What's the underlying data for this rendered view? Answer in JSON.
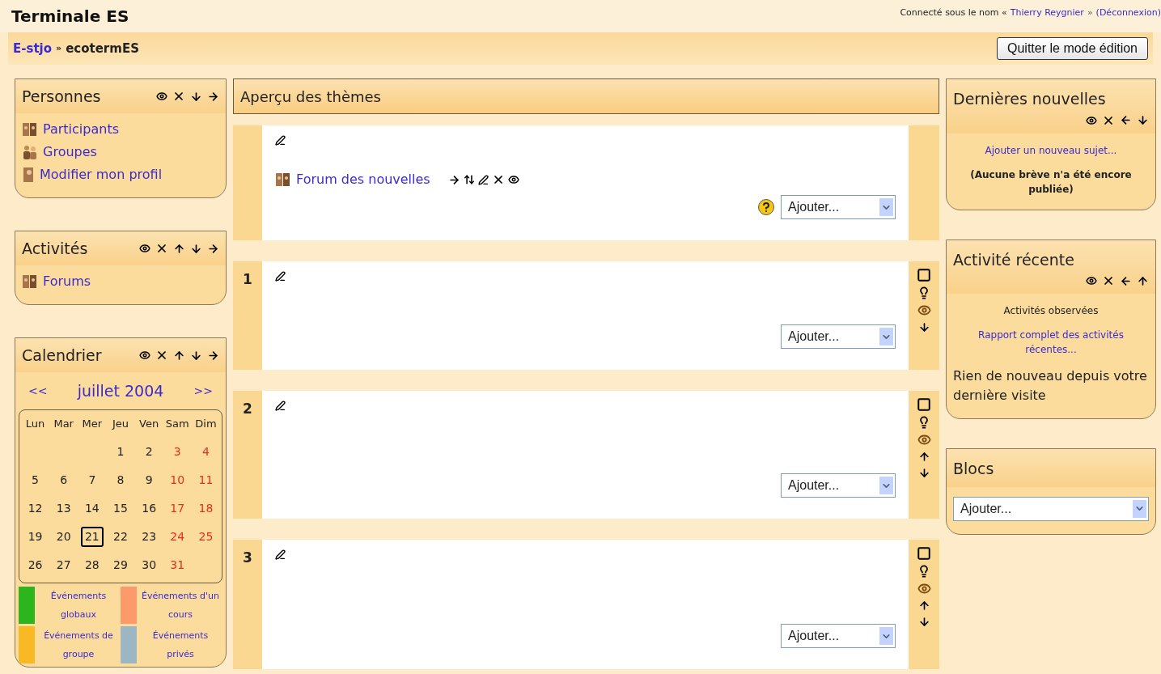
{
  "header": {
    "title": "Terminale ES",
    "login_prefix": "Connecté sous le nom «",
    "user": "Thierry Reygnier",
    "login_sep": "»",
    "logout": "(Déconnexion)"
  },
  "breadcrumb": {
    "home": "E-stjo",
    "separator": "»",
    "current": "ecotermES"
  },
  "edit_button": "Quitter le mode édition",
  "left_blocks": [
    {
      "kind": "links",
      "title": "Personnes",
      "controls": [
        {
          "kind": "hide"
        },
        {
          "kind": "delete"
        },
        {
          "kind": "down"
        },
        {
          "kind": "right"
        }
      ],
      "items": [
        {
          "kind": "people",
          "text": "Participants"
        },
        {
          "kind": "group",
          "text": "Groupes"
        },
        {
          "kind": "person",
          "text": "Modifier mon profil"
        }
      ]
    },
    {
      "kind": "links",
      "title": "Activités",
      "controls": [
        {
          "kind": "hide"
        },
        {
          "kind": "delete"
        },
        {
          "kind": "up"
        },
        {
          "kind": "down"
        },
        {
          "kind": "right"
        }
      ],
      "items": [
        {
          "kind": "people",
          "text": "Forums"
        }
      ]
    },
    {
      "kind": "calendar",
      "title": "Calendrier",
      "controls": [
        {
          "kind": "hide"
        },
        {
          "kind": "delete"
        },
        {
          "kind": "up"
        },
        {
          "kind": "down"
        },
        {
          "kind": "right"
        }
      ],
      "calendar": {
        "prev": "<<",
        "month": "juillet 2004",
        "next": ">>",
        "weekdays": [
          "Lun",
          "Mar",
          "Mer",
          "Jeu",
          "Ven",
          "Sam",
          "Dim"
        ],
        "weeks": [
          [
            {
              "kind": "blank"
            },
            {
              "kind": "blank"
            },
            {
              "kind": "blank"
            },
            {
              "kind": "day",
              "text": "1",
              "weekend": false,
              "today": false
            },
            {
              "kind": "day",
              "text": "2",
              "weekend": false,
              "today": false
            },
            {
              "kind": "day",
              "text": "3",
              "weekend": true,
              "today": false
            },
            {
              "kind": "day",
              "text": "4",
              "weekend": true,
              "today": false
            }
          ],
          [
            {
              "kind": "day",
              "text": "5",
              "weekend": false,
              "today": false
            },
            {
              "kind": "day",
              "text": "6",
              "weekend": false,
              "today": false
            },
            {
              "kind": "day",
              "text": "7",
              "weekend": false,
              "today": false
            },
            {
              "kind": "day",
              "text": "8",
              "weekend": false,
              "today": false
            },
            {
              "kind": "day",
              "text": "9",
              "weekend": false,
              "today": false
            },
            {
              "kind": "day",
              "text": "10",
              "weekend": true,
              "today": false
            },
            {
              "kind": "day",
              "text": "11",
              "weekend": true,
              "today": false
            }
          ],
          [
            {
              "kind": "day",
              "text": "12",
              "weekend": false,
              "today": false
            },
            {
              "kind": "day",
              "text": "13",
              "weekend": false,
              "today": false
            },
            {
              "kind": "day",
              "text": "14",
              "weekend": false,
              "today": false
            },
            {
              "kind": "day",
              "text": "15",
              "weekend": false,
              "today": false
            },
            {
              "kind": "day",
              "text": "16",
              "weekend": false,
              "today": false
            },
            {
              "kind": "day",
              "text": "17",
              "weekend": true,
              "today": false
            },
            {
              "kind": "day",
              "text": "18",
              "weekend": true,
              "today": false
            }
          ],
          [
            {
              "kind": "day",
              "text": "19",
              "weekend": false,
              "today": false
            },
            {
              "kind": "day",
              "text": "20",
              "weekend": false,
              "today": false
            },
            {
              "kind": "day",
              "text": "21",
              "weekend": false,
              "today": true
            },
            {
              "kind": "day",
              "text": "22",
              "weekend": false,
              "today": false
            },
            {
              "kind": "day",
              "text": "23",
              "weekend": false,
              "today": false
            },
            {
              "kind": "day",
              "text": "24",
              "weekend": true,
              "today": false
            },
            {
              "kind": "day",
              "text": "25",
              "weekend": true,
              "today": false
            }
          ],
          [
            {
              "kind": "day",
              "text": "26",
              "weekend": false,
              "today": false
            },
            {
              "kind": "day",
              "text": "27",
              "weekend": false,
              "today": false
            },
            {
              "kind": "day",
              "text": "28",
              "weekend": false,
              "today": false
            },
            {
              "kind": "day",
              "text": "29",
              "weekend": false,
              "today": false
            },
            {
              "kind": "day",
              "text": "30",
              "weekend": false,
              "today": false
            },
            {
              "kind": "day",
              "text": "31",
              "weekend": true,
              "today": false
            }
          ]
        ],
        "legend": [
          {
            "text": "Événements globaux",
            "color": "#2db51e"
          },
          {
            "text": "Événements d'un cours",
            "color": "#fc9a6c"
          },
          {
            "text": "Événements de groupe",
            "color": "#f8b924"
          },
          {
            "text": "Événements privés",
            "color": "#9cb6c4"
          }
        ]
      }
    }
  ],
  "main": {
    "title": "Aperçu des thèmes",
    "sections": [
      {
        "activities": [
          {
            "text": "Forum des nouvelles",
            "actions": [
              {
                "kind": "right"
              },
              {
                "kind": "updown"
              },
              {
                "kind": "edit"
              },
              {
                "kind": "delete"
              },
              {
                "kind": "hide"
              }
            ]
          }
        ],
        "help": true,
        "select": "Ajouter..."
      },
      {
        "number": "1",
        "controls": [
          {
            "kind": "highlight"
          },
          {
            "kind": "light"
          },
          {
            "kind": "show"
          },
          {
            "kind": "down"
          }
        ],
        "help": false,
        "select": "Ajouter..."
      },
      {
        "number": "2",
        "controls": [
          {
            "kind": "highlight"
          },
          {
            "kind": "light"
          },
          {
            "kind": "show"
          },
          {
            "kind": "up"
          },
          {
            "kind": "down"
          }
        ],
        "help": false,
        "select": "Ajouter..."
      },
      {
        "number": "3",
        "controls": [
          {
            "kind": "highlight"
          },
          {
            "kind": "light"
          },
          {
            "kind": "show"
          },
          {
            "kind": "up"
          },
          {
            "kind": "down"
          }
        ],
        "help": false,
        "select": "Ajouter..."
      }
    ]
  },
  "right_blocks": [
    {
      "title": "Dernières nouvelles",
      "controls": [
        {
          "kind": "hide"
        },
        {
          "kind": "delete"
        },
        {
          "kind": "left"
        },
        {
          "kind": "down"
        }
      ],
      "body": [
        {
          "kind": "link",
          "text": "Ajouter un nouveau sujet..."
        },
        {
          "kind": "note",
          "text": "(Aucune brève n'a été encore publiée)"
        }
      ]
    },
    {
      "title": "Activité récente",
      "controls": [
        {
          "kind": "hide"
        },
        {
          "kind": "delete"
        },
        {
          "kind": "left"
        },
        {
          "kind": "up"
        }
      ],
      "body": [
        {
          "kind": "small",
          "text": "Activités observées"
        },
        {
          "kind": "link",
          "text": "Rapport complet des activités récentes..."
        },
        {
          "kind": "text",
          "text": "Rien de nouveau depuis votre dernière visite"
        }
      ]
    },
    {
      "title": "Blocs",
      "body": [
        {
          "kind": "select",
          "text": "Ajouter..."
        }
      ]
    }
  ]
}
